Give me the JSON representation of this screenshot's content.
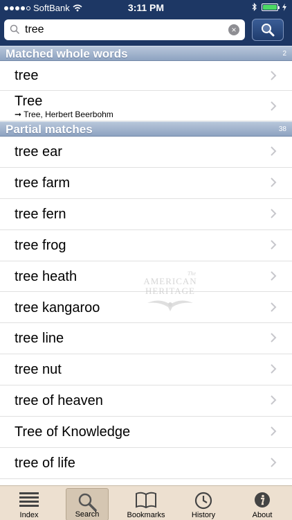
{
  "status": {
    "carrier": "SoftBank",
    "time": "3:11 PM"
  },
  "search": {
    "query": "tree"
  },
  "sections": {
    "matched": {
      "title": "Matched whole words",
      "count": "2"
    },
    "partial": {
      "title": "Partial matches",
      "count": "38"
    }
  },
  "matched_rows": [
    {
      "word": "tree"
    },
    {
      "word": "Tree",
      "sub": "➞ Tree, Herbert Beerbohm"
    }
  ],
  "partial_rows": [
    {
      "word": "tree ear"
    },
    {
      "word": "tree farm"
    },
    {
      "word": "tree fern"
    },
    {
      "word": "tree frog"
    },
    {
      "word": "tree heath"
    },
    {
      "word": "tree kangaroo"
    },
    {
      "word": "tree line"
    },
    {
      "word": "tree nut"
    },
    {
      "word": "tree of heaven"
    },
    {
      "word": "Tree of Knowledge"
    },
    {
      "word": "tree of life"
    }
  ],
  "watermark": {
    "line1": "The",
    "line2": "AMERICAN",
    "line3": "HERITAGE"
  },
  "tabs": [
    {
      "label": "Index"
    },
    {
      "label": "Search"
    },
    {
      "label": "Bookmarks"
    },
    {
      "label": "History"
    },
    {
      "label": "About"
    }
  ],
  "colors": {
    "nav": "#1d3764",
    "section": "#9fb1cb",
    "tabbar": "#ede0d0",
    "battery": "#4cd964"
  }
}
